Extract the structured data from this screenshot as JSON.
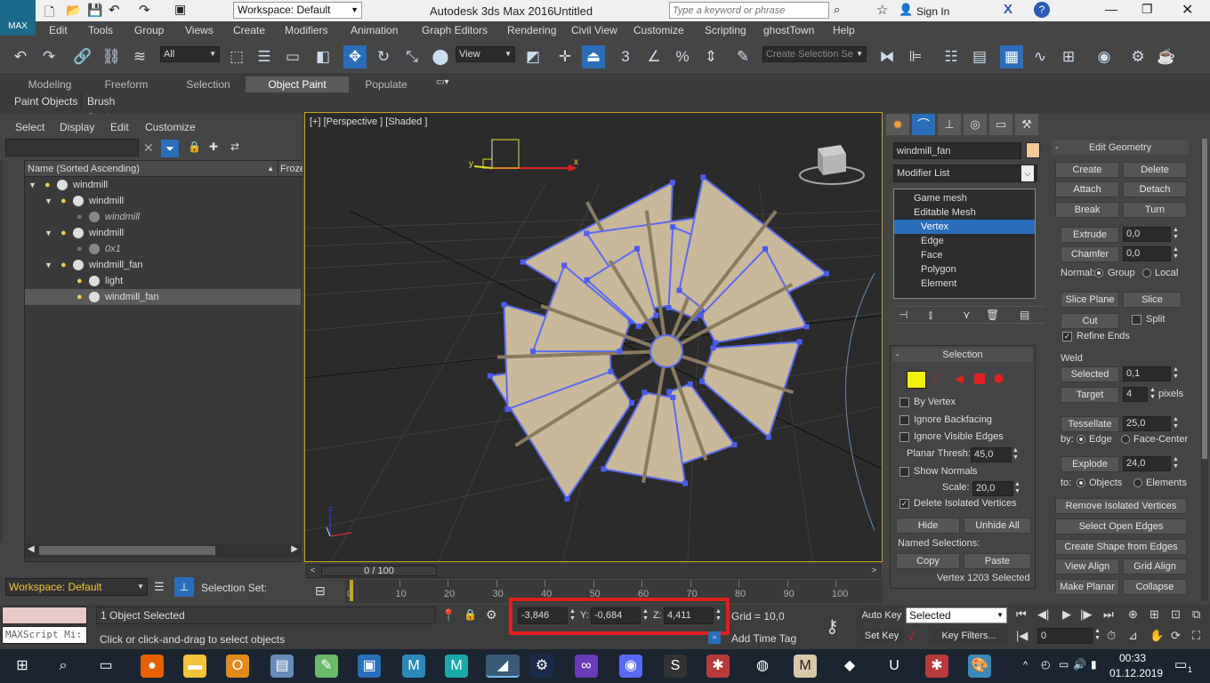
{
  "title": {
    "app": "Autodesk 3ds Max 2016",
    "doc": "Untitled",
    "workspace": "Workspace: Default",
    "search_placeholder": "Type a keyword or phrase",
    "signin": "Sign In",
    "logo": "MAX"
  },
  "menu": [
    "Edit",
    "Tools",
    "Group",
    "Views",
    "Create",
    "Modifiers",
    "Animation",
    "Graph Editors",
    "Rendering",
    "Civil View",
    "Customize",
    "Scripting",
    "ghostTown",
    "Help"
  ],
  "toolbar": {
    "filter": "All",
    "refcoord": "View",
    "selset_placeholder": "Create Selection Se",
    "snap_labels": [
      "3",
      "%"
    ]
  },
  "ribbon": {
    "tabs": [
      "Modeling",
      "Freeform",
      "Selection",
      "Object Paint",
      "Populate"
    ],
    "active": "Object Paint",
    "subtabs": [
      "Paint Objects",
      "Brush Settings"
    ]
  },
  "scene": {
    "menu": [
      "Select",
      "Display",
      "Edit",
      "Customize"
    ],
    "col_name": "Name (Sorted Ascending)",
    "col_frozen": "Frozen",
    "rows": [
      {
        "label": "windmill",
        "level": 0
      },
      {
        "label": "windmill",
        "level": 1
      },
      {
        "label": "windmill",
        "level": 2,
        "italic": true
      },
      {
        "label": "windmill",
        "level": 1
      },
      {
        "label": "0x1",
        "level": 2,
        "italic": true
      },
      {
        "label": "windmill_fan",
        "level": 1
      },
      {
        "label": "light",
        "level": 2
      },
      {
        "label": "windmill_fan",
        "level": 2,
        "selected": true
      }
    ],
    "workspace": "Workspace: Default",
    "selection_set": "Selection Set:"
  },
  "viewport": {
    "label": "[+] [Perspective ] [Shaded ]",
    "axes": {
      "x": "x",
      "y": "y",
      "z": "z"
    }
  },
  "cmd": {
    "object_name": "windmill_fan",
    "modifier_list": "Modifier List",
    "stack": [
      "Game mesh",
      "Editable Mesh",
      "Vertex",
      "Edge",
      "Face",
      "Polygon",
      "Element"
    ],
    "selection": {
      "title": "Selection",
      "by_vertex": "By Vertex",
      "ignore_backfacing": "Ignore Backfacing",
      "ignore_visible_edges": "Ignore Visible Edges",
      "planar_thresh": "Planar Thresh:",
      "planar_val": "45,0",
      "show_normals": "Show Normals",
      "scale": "Scale:",
      "scale_val": "20,0",
      "delete_isolated": "Delete Isolated Vertices",
      "hide": "Hide",
      "unhide_all": "Unhide All",
      "named_selections": "Named Selections:",
      "copy": "Copy",
      "paste": "Paste",
      "status": "Vertex 1203 Selected"
    },
    "edit_geometry": {
      "title": "Edit Geometry",
      "create": "Create",
      "delete": "Delete",
      "attach": "Attach",
      "detach": "Detach",
      "break": "Break",
      "turn": "Turn",
      "extrude": "Extrude",
      "extrude_val": "0,0",
      "chamfer": "Chamfer",
      "chamfer_val": "0,0",
      "normal": "Normal:",
      "group": "Group",
      "local": "Local",
      "slice_plane": "Slice Plane",
      "slice": "Slice",
      "cut": "Cut",
      "split": "Split",
      "refine_ends": "Refine Ends",
      "weld": "Weld",
      "selected": "Selected",
      "selected_val": "0,1",
      "target": "Target",
      "target_val": "4",
      "pixels": "pixels",
      "tessellate": "Tessellate",
      "tess_val": "25,0",
      "by": "by:",
      "edge": "Edge",
      "face_center": "Face-Center",
      "explode": "Explode",
      "explode_val": "24,0",
      "to": "to:",
      "objects": "Objects",
      "elements": "Elements",
      "remove_isolated": "Remove Isolated Vertices",
      "select_open_edges": "Select Open Edges",
      "create_shape": "Create Shape from Edges",
      "view_align": "View Align",
      "grid_align": "Grid Align",
      "make_planar": "Make Planar",
      "collapse": "Collapse"
    }
  },
  "timeline": {
    "frame": "0 / 100",
    "ticks": [
      "0",
      "10",
      "20",
      "30",
      "40",
      "50",
      "60",
      "70",
      "80",
      "90",
      "100"
    ]
  },
  "status": {
    "maxscript": "MAXScript Mi:",
    "objects_selected": "1 Object Selected",
    "prompt": "Click or click-and-drag to select objects",
    "x": "-3,846",
    "y": "-0,684",
    "z": "4,411",
    "x_lbl": "X:",
    "y_lbl": "Y:",
    "z_lbl": "Z:",
    "grid": "Grid = 10,0",
    "add_time_tag": "Add Time Tag",
    "auto_key": "Auto Key",
    "set_key": "Set Key",
    "key_mode": "Selected",
    "key_filters": "Key Filters...",
    "frame": "0"
  },
  "taskbar": {
    "time": "00:33",
    "date": "01.12.2019",
    "notification_count": "1"
  },
  "colors": {
    "accent": "#2a6db8",
    "highlight_box": "#e0201e",
    "vertex": "#4a5cf0",
    "viewport_border": "#c8a418"
  }
}
